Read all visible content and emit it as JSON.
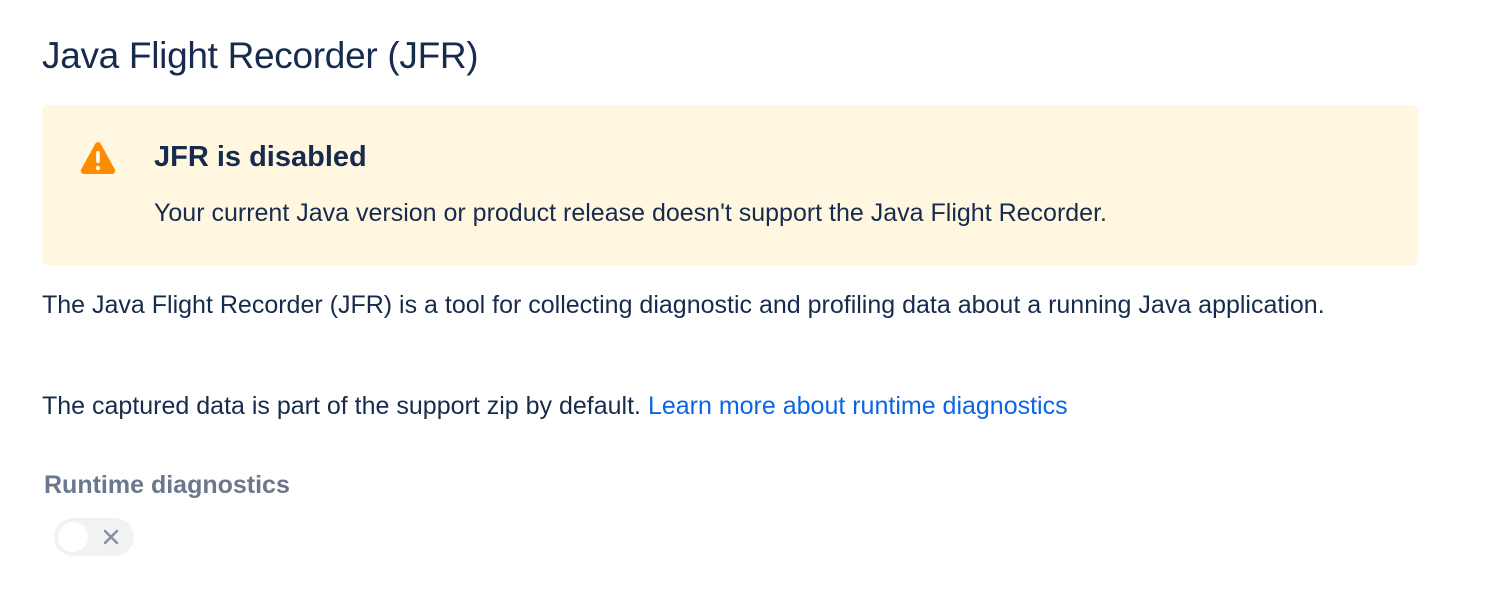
{
  "page": {
    "title": "Java Flight Recorder (JFR)"
  },
  "banner": {
    "icon": "warning-icon",
    "icon_color": "#ff8b00",
    "background": "#fff7e0",
    "title": "JFR is disabled",
    "message": "Your current Java version or product release doesn't support the Java Flight Recorder."
  },
  "content": {
    "description": "The Java Flight Recorder (JFR) is a tool for collecting diagnostic and profiling data about a running Java application.",
    "zip_text": "The captured data is part of the support zip by default.",
    "link_label": "Learn more about runtime diagnostics",
    "link_color": "#0c66e4"
  },
  "runtime_diagnostics": {
    "label": "Runtime diagnostics",
    "toggle_state": "off",
    "toggle_disabled": true,
    "toggle_icon": "close-icon"
  }
}
